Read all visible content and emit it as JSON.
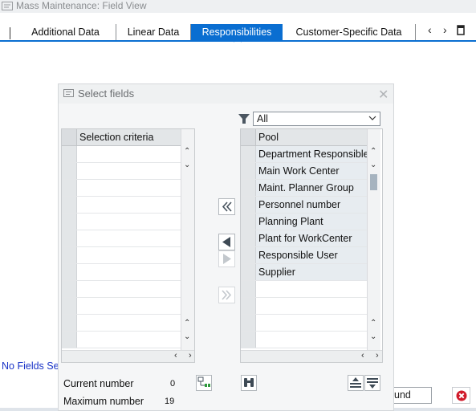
{
  "window": {
    "title": "Mass Maintenance: Field View"
  },
  "tabs": [
    {
      "label": "Additional Data",
      "active": false
    },
    {
      "label": "Linear Data",
      "active": false
    },
    {
      "label": "Responsibilities",
      "active": true
    },
    {
      "label": "Customer-Specific Data",
      "active": false
    }
  ],
  "tab_nav": {
    "prev": "‹",
    "next": "›"
  },
  "background": {
    "no_fields_text": "No Fields Se",
    "partial_button_label": "und"
  },
  "dialog": {
    "title": "Select fields",
    "filter_value": "All",
    "left_table": {
      "header": "Selection criteria",
      "rows": [
        "",
        "",
        "",
        "",
        "",
        "",
        "",
        "",
        "",
        "",
        "",
        ""
      ]
    },
    "right_table": {
      "header": "Pool",
      "rows": [
        "Department Responsible",
        "Main Work Center",
        "Maint. Planner Group",
        "Personnel number",
        "Planning Plant",
        "Plant for WorkCenter",
        "Responsible User",
        "Supplier",
        "",
        "",
        "",
        ""
      ]
    },
    "current_number_label": "Current number",
    "current_number_value": "0",
    "maximum_number_label": "Maximum number",
    "maximum_number_value": "19"
  },
  "colors": {
    "accent": "#0a6ed1",
    "link": "#1933c7",
    "close_red": "#d11a2a"
  }
}
